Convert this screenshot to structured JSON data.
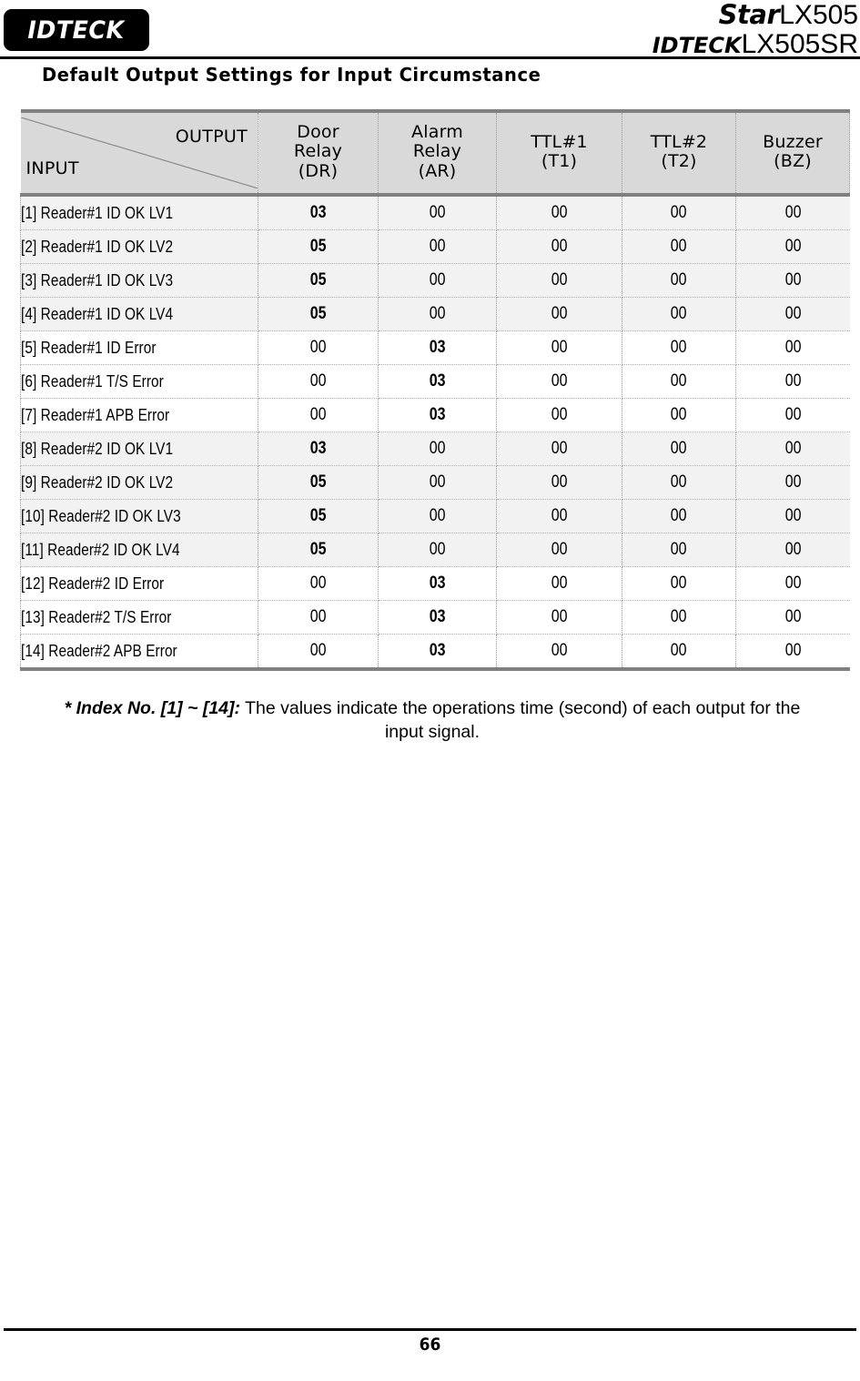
{
  "header": {
    "logo_text": "IDTECK",
    "model_top_brand": "Star",
    "model_top_number": "LX505",
    "model_bottom_brand": "IDTECK",
    "model_bottom_number": "LX505SR"
  },
  "title": "Default Output Settings for Input Circumstance",
  "table": {
    "corner": {
      "output_label": "OUTPUT",
      "input_label": "INPUT"
    },
    "columns": [
      {
        "id": "dr",
        "line1": "Door",
        "line2": "Relay",
        "line3": "(DR)"
      },
      {
        "id": "ar",
        "line1": "Alarm",
        "line2": "Relay",
        "line3": "(AR)"
      },
      {
        "id": "t1",
        "line1": "TTL#1",
        "line2": "(T1)",
        "line3": ""
      },
      {
        "id": "t2",
        "line1": "TTL#2",
        "line2": "(T2)",
        "line3": ""
      },
      {
        "id": "bz",
        "line1": "Buzzer",
        "line2": "(BZ)",
        "line3": ""
      }
    ],
    "rows": [
      {
        "input": "[1] Reader#1 ID OK LV1",
        "shaded": true,
        "dr": "03",
        "dr_bold": true,
        "ar": "00",
        "ar_bold": false,
        "t1": "00",
        "t2": "00",
        "bz": "00"
      },
      {
        "input": "[2] Reader#1 ID OK LV2",
        "shaded": true,
        "dr": "05",
        "dr_bold": true,
        "ar": "00",
        "ar_bold": false,
        "t1": "00",
        "t2": "00",
        "bz": "00"
      },
      {
        "input": "[3] Reader#1 ID OK LV3",
        "shaded": true,
        "dr": "05",
        "dr_bold": true,
        "ar": "00",
        "ar_bold": false,
        "t1": "00",
        "t2": "00",
        "bz": "00"
      },
      {
        "input": "[4] Reader#1 ID OK LV4",
        "shaded": true,
        "dr": "05",
        "dr_bold": true,
        "ar": "00",
        "ar_bold": false,
        "t1": "00",
        "t2": "00",
        "bz": "00"
      },
      {
        "input": "[5] Reader#1 ID Error",
        "shaded": false,
        "dr": "00",
        "dr_bold": false,
        "ar": "03",
        "ar_bold": true,
        "t1": "00",
        "t2": "00",
        "bz": "00"
      },
      {
        "input": "[6] Reader#1 T/S Error",
        "shaded": false,
        "dr": "00",
        "dr_bold": false,
        "ar": "03",
        "ar_bold": true,
        "t1": "00",
        "t2": "00",
        "bz": "00"
      },
      {
        "input": "[7] Reader#1 APB Error",
        "shaded": false,
        "dr": "00",
        "dr_bold": false,
        "ar": "03",
        "ar_bold": true,
        "t1": "00",
        "t2": "00",
        "bz": "00"
      },
      {
        "input": "[8] Reader#2 ID OK   LV1",
        "shaded": true,
        "dr": "03",
        "dr_bold": true,
        "ar": "00",
        "ar_bold": false,
        "t1": "00",
        "t2": "00",
        "bz": "00"
      },
      {
        "input": "[9] Reader#2 ID OK   LV2",
        "shaded": true,
        "dr": "05",
        "dr_bold": true,
        "ar": "00",
        "ar_bold": false,
        "t1": "00",
        "t2": "00",
        "bz": "00"
      },
      {
        "input": "[10] Reader#2 ID OK   LV3",
        "shaded": true,
        "dr": "05",
        "dr_bold": true,
        "ar": "00",
        "ar_bold": false,
        "t1": "00",
        "t2": "00",
        "bz": "00"
      },
      {
        "input": "[11] Reader#2 ID OK   LV4",
        "shaded": true,
        "dr": "05",
        "dr_bold": true,
        "ar": "00",
        "ar_bold": false,
        "t1": "00",
        "t2": "00",
        "bz": "00"
      },
      {
        "input": "[12] Reader#2 ID Error",
        "shaded": false,
        "dr": "00",
        "dr_bold": false,
        "ar": "03",
        "ar_bold": true,
        "t1": "00",
        "t2": "00",
        "bz": "00"
      },
      {
        "input": "[13] Reader#2 T/S Error",
        "shaded": false,
        "dr": "00",
        "dr_bold": false,
        "ar": "03",
        "ar_bold": true,
        "t1": "00",
        "t2": "00",
        "bz": "00"
      },
      {
        "input": "[14] Reader#2 APB Error",
        "shaded": false,
        "dr": "00",
        "dr_bold": false,
        "ar": "03",
        "ar_bold": true,
        "t1": "00",
        "t2": "00",
        "bz": "00"
      }
    ]
  },
  "note": {
    "emphasis": "* Index No. [1] ~ [14]:",
    "body": " The values indicate the operations time (second) of each output for the input signal."
  },
  "footer": {
    "page_number": "66"
  },
  "colors": {
    "header_fill": "#d9d9d9",
    "row_shaded": "#f2f2f2",
    "rule": "#000000",
    "table_border": "#808080",
    "cell_divider": "#9a9a9a"
  }
}
